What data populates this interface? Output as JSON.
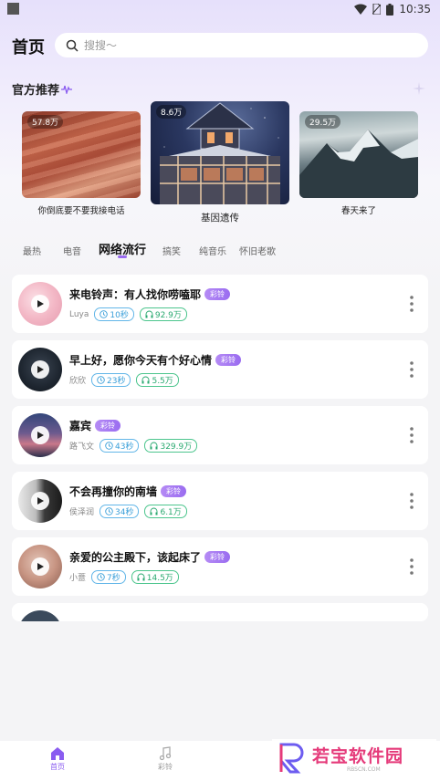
{
  "status_bar": {
    "time": "10:35"
  },
  "header": {
    "title": "首页",
    "search_placeholder": "搜搜～"
  },
  "section": {
    "title": "官方推荐"
  },
  "featured": [
    {
      "count": "57.8万",
      "caption": "你倒底要不要我接电话"
    },
    {
      "count": "8.6万",
      "caption": "基因遗传"
    },
    {
      "count": "29.5万",
      "caption": "春天来了"
    }
  ],
  "tabs": [
    "最热",
    "电音",
    "网络流行",
    "搞笑",
    "纯音乐",
    "怀旧老歌"
  ],
  "active_tab": "网络流行",
  "songs": [
    {
      "title": "来电铃声：有人找你唠嗑耶",
      "badge": "彩铃",
      "artist": "Luya",
      "duration": "10秒",
      "plays": "92.9万"
    },
    {
      "title": "早上好，愿你今天有个好心情",
      "badge": "彩铃",
      "artist": "欣欣",
      "duration": "23秒",
      "plays": "5.5万"
    },
    {
      "title": "嘉宾",
      "badge": "彩铃",
      "artist": "路飞文",
      "duration": "43秒",
      "plays": "329.9万"
    },
    {
      "title": "不会再撞你的南墙",
      "badge": "彩铃",
      "artist": "侯泽润",
      "duration": "34秒",
      "plays": "6.1万"
    },
    {
      "title": "亲爱的公主殿下，该起床了",
      "badge": "彩铃",
      "artist": "小薏",
      "duration": "7秒",
      "plays": "14.5万"
    }
  ],
  "bottom_nav": {
    "home": "首页",
    "ringtone": "彩铃"
  },
  "watermark": {
    "text": "若宝软件园",
    "sub": "RBSCN.COM"
  },
  "colors": {
    "accent": "#9b6cf1",
    "duration": "#3a9fd9",
    "plays": "#2aa970",
    "badge": "#a57af3"
  }
}
